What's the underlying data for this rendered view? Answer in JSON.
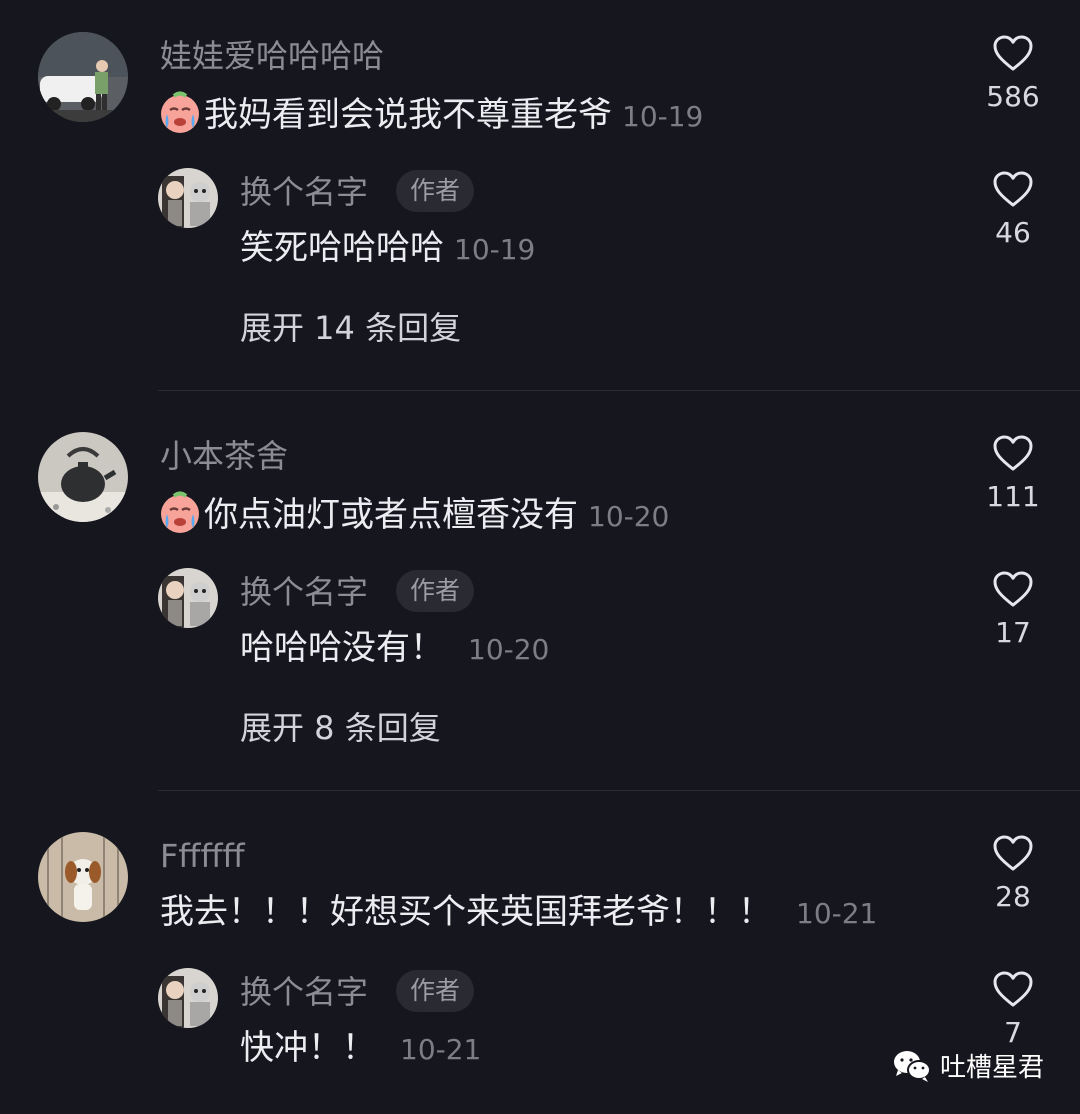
{
  "comments": [
    {
      "username": "娃娃爱哈哈哈哈",
      "text": "我妈看到会说我不尊重老爷",
      "date": "10-19",
      "likes": "586",
      "avatar_icon": "person-car-photo",
      "reply": {
        "username": "换个名字",
        "badge": "作者",
        "text": "笑死哈哈哈哈",
        "date": "10-19",
        "likes": "46"
      },
      "expand": "展开 14 条回复"
    },
    {
      "username": "小本茶舍",
      "text": "你点油灯或者点檀香没有",
      "date": "10-20",
      "likes": "111",
      "avatar_icon": "teapot-photo",
      "reply": {
        "username": "换个名字",
        "badge": "作者",
        "text": "哈哈哈没有！",
        "date": "10-20",
        "likes": "17"
      },
      "expand": "展开 8 条回复"
    },
    {
      "username": "Fffffff",
      "text": "我去！！！好想买个来英国拜老爷！！！",
      "date": "10-21",
      "likes": "28",
      "avatar_icon": "puppy-photo",
      "reply": {
        "username": "换个名字",
        "badge": "作者",
        "text": "快冲！！",
        "date": "10-21",
        "likes": "7"
      }
    }
  ],
  "watermark": "吐槽星君",
  "colors": {
    "background": "#16161e",
    "username": "#8c8c97",
    "text": "#ececf1",
    "date": "#7d7d88"
  }
}
